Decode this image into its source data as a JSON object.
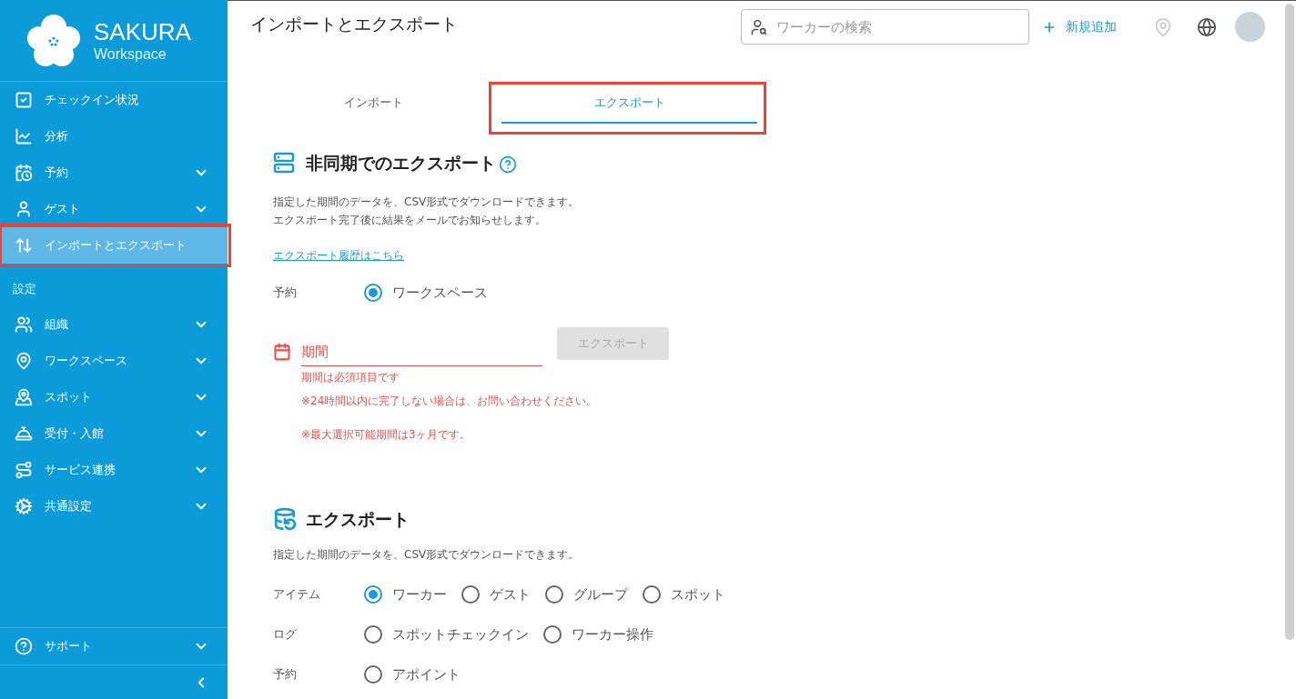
{
  "sidebar": {
    "logo": {
      "title": "SAKURA",
      "subtitle": "Workspace"
    },
    "items": [
      {
        "label": "チェックイン状況",
        "expandable": false,
        "selected": false,
        "highlighted": false
      },
      {
        "label": "分析",
        "expandable": false,
        "selected": false,
        "highlighted": false
      },
      {
        "label": "予約",
        "expandable": true,
        "selected": false,
        "highlighted": false
      },
      {
        "label": "ゲスト",
        "expandable": true,
        "selected": false,
        "highlighted": false
      },
      {
        "label": "インポートとエクスポート",
        "expandable": false,
        "selected": true,
        "highlighted": true
      }
    ],
    "settings_label": "設定",
    "settings_items": [
      {
        "label": "組織",
        "expandable": true
      },
      {
        "label": "ワークスペース",
        "expandable": true
      },
      {
        "label": "スポット",
        "expandable": true
      },
      {
        "label": "受付・入館",
        "expandable": true
      },
      {
        "label": "サービス連携",
        "expandable": true
      },
      {
        "label": "共通設定",
        "expandable": true
      }
    ],
    "support": {
      "label": "サポート",
      "expandable": true
    }
  },
  "header": {
    "title": "インポートとエクスポート",
    "search": {
      "placeholder": "ワーカーの検索"
    },
    "add_button": "新規追加"
  },
  "tabs": [
    {
      "label": "インポート",
      "selected": false,
      "highlighted": false
    },
    {
      "label": "エクスポート",
      "selected": true,
      "highlighted": true
    }
  ],
  "async_export": {
    "title": "非同期でのエクスポート",
    "description": [
      "指定した期間のデータを、CSV形式でダウンロードできます。",
      "エクスポート完了後に結果をメールでお知らせします。"
    ],
    "history_link": "エクスポート履歴はこちら",
    "reservation": {
      "label": "予約",
      "options": [
        {
          "label": "ワークスペース",
          "selected": true
        }
      ]
    },
    "period": {
      "label": "期間",
      "invalid": true,
      "error": "期間は必須項目です"
    },
    "export_button": {
      "label": "エクスポート",
      "disabled": true
    },
    "notes": [
      "※24時間以内に完了しない場合は、お問い合わせください。",
      "※最大選択可能期間は3ヶ月です。"
    ]
  },
  "export": {
    "title": "エクスポート",
    "description": "指定した期間のデータを、CSV形式でダウンロードできます。",
    "groups": [
      {
        "label": "アイテム",
        "options": [
          {
            "label": "ワーカー",
            "selected": true
          },
          {
            "label": "ゲスト",
            "selected": false
          },
          {
            "label": "グループ",
            "selected": false
          },
          {
            "label": "スポット",
            "selected": false
          }
        ]
      },
      {
        "label": "ログ",
        "options": [
          {
            "label": "スポットチェックイン",
            "selected": false
          },
          {
            "label": "ワーカー操作",
            "selected": false
          }
        ]
      },
      {
        "label": "予約",
        "options": [
          {
            "label": "アポイント",
            "selected": false
          }
        ]
      }
    ]
  }
}
